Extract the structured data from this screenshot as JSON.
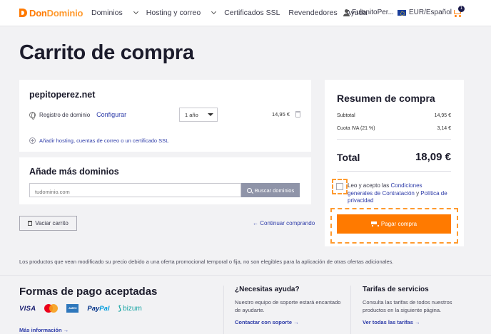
{
  "header": {
    "logo_part1": "Don",
    "logo_part2": "Dominio",
    "nav": [
      "Dominios",
      "Hosting y correo",
      "Certificados SSL",
      "Revendedores",
      "Ayuda"
    ],
    "user": "FulanitoPer...",
    "language": "EUR/Español",
    "cart_count": "1"
  },
  "page_title": "Carrito de compra",
  "cart_item": {
    "domain": "pepitoperez.net",
    "type": "Registro de dominio",
    "configure": "Configurar",
    "period": "1 año",
    "price": "14,95 €",
    "add_services": "Añadir hosting, cuentas de correo o un certificado SSL"
  },
  "more_domains": {
    "title": "Añade más dominios",
    "placeholder": "tudominio.com",
    "search_button": "Buscar dominios"
  },
  "actions": {
    "empty_cart": "Vaciar carrito",
    "continue": "← Continuar comprando"
  },
  "summary": {
    "title": "Resumen de compra",
    "subtotal_label": "Subtotal",
    "subtotal_value": "14,95 €",
    "tax_label": "Cuota IVA (21 %)",
    "tax_value": "3,14 €",
    "total_label": "Total",
    "total_value": "18,09 €",
    "terms_prefix": "Leo y acepto las ",
    "terms_link1": "Condiciones generales de Contratación",
    "terms_and": " y ",
    "terms_link2": "Política de privacidad",
    "pay_button": "Pagar compra"
  },
  "promo_note": "Los productos que vean modificado su precio debido a una oferta promocional temporal o fija, no son elegibles para la aplicación de otras ofertas adicionales.",
  "footer": {
    "payments_title": "Formas de pago aceptadas",
    "visa": "VISA",
    "amex": "AMEX",
    "paypal1": "Pay",
    "paypal2": "Pal",
    "bizum": "bizum",
    "more_info": "Más información →",
    "help_title": "¿Necesitas ayuda?",
    "help_text": "Nuestro equipo de soporte estará encantado de ayudarte.",
    "help_link": "Contactar con soporte →",
    "rates_title": "Tarifas de servicios",
    "rates_text": "Consulta las tarifas de todos nuestros productos en la siguiente página.",
    "rates_link": "Ver todas las tarifas →"
  },
  "colors": {
    "accent": "#ff7a00",
    "link": "#2d3ba8",
    "text": "#1b1b2b"
  }
}
